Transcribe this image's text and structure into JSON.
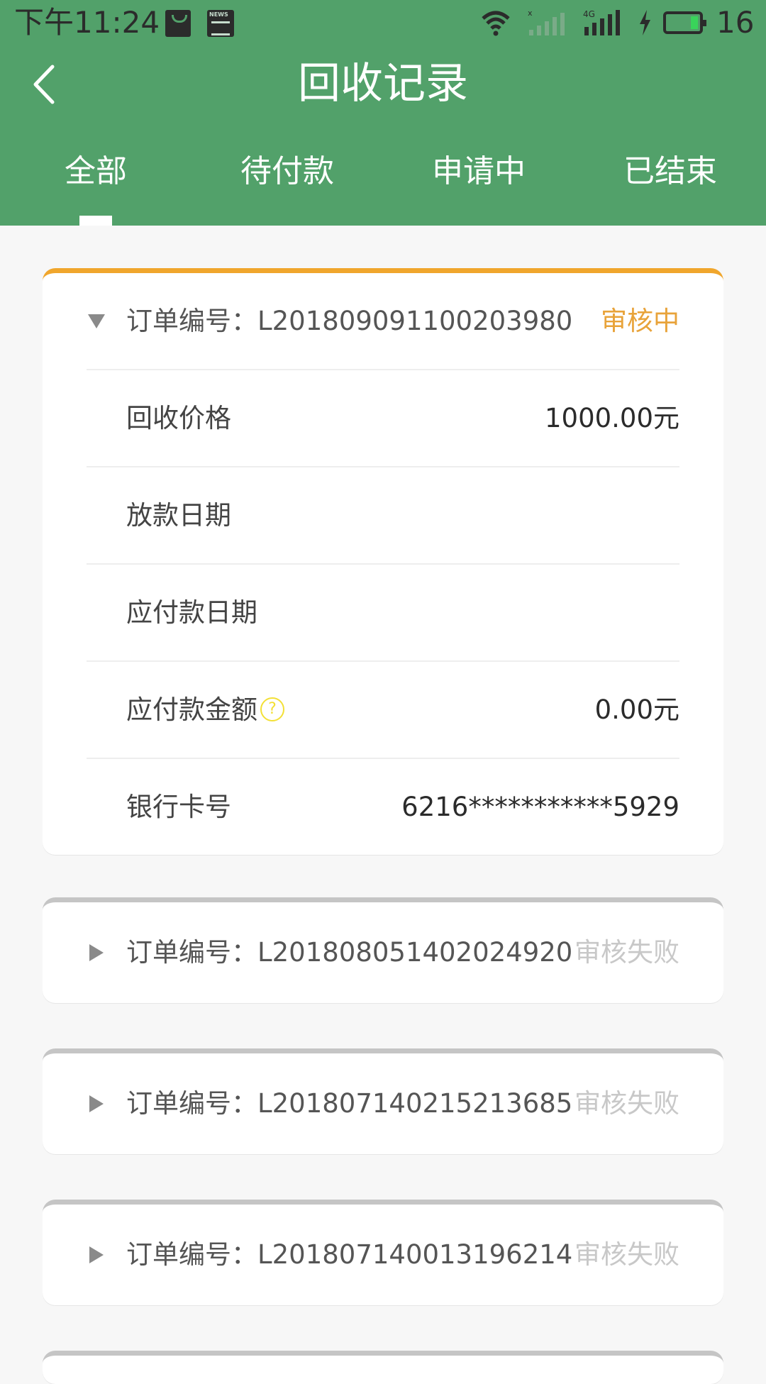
{
  "status_bar": {
    "time": "下午11:24",
    "battery": "16",
    "icons": [
      "shopping-bag-icon",
      "news-icon",
      "wifi-icon",
      "signal-icon",
      "4g-signal-icon",
      "charging-icon",
      "battery-icon"
    ]
  },
  "header": {
    "title": "回收记录",
    "back_icon": "chevron-left-icon",
    "background": "#52a16a"
  },
  "tabs": [
    {
      "label": "全部",
      "active": true
    },
    {
      "label": "待付款",
      "active": false
    },
    {
      "label": "申请中",
      "active": false
    },
    {
      "label": "已结束",
      "active": false
    }
  ],
  "orders": [
    {
      "order_label": "订单编号：L201809091100203980",
      "status": "审核中",
      "status_color": "#e8a33a",
      "expanded": true,
      "fields": [
        {
          "label": "回收价格",
          "value": "1000.00元"
        },
        {
          "label": "放款日期",
          "value": ""
        },
        {
          "label": "应付款日期",
          "value": ""
        },
        {
          "label": "应付款金额",
          "value": "0.00元",
          "help_icon": "?"
        },
        {
          "label": "银行卡号",
          "value": "6216***********5929"
        }
      ]
    },
    {
      "order_label": "订单编号：L201808051402024920",
      "status": "审核失败",
      "expanded": false
    },
    {
      "order_label": "订单编号：L201807140215213685",
      "status": "审核失败",
      "expanded": false
    },
    {
      "order_label": "订单编号：L201807140013196214",
      "status": "审核失败",
      "expanded": false
    }
  ]
}
